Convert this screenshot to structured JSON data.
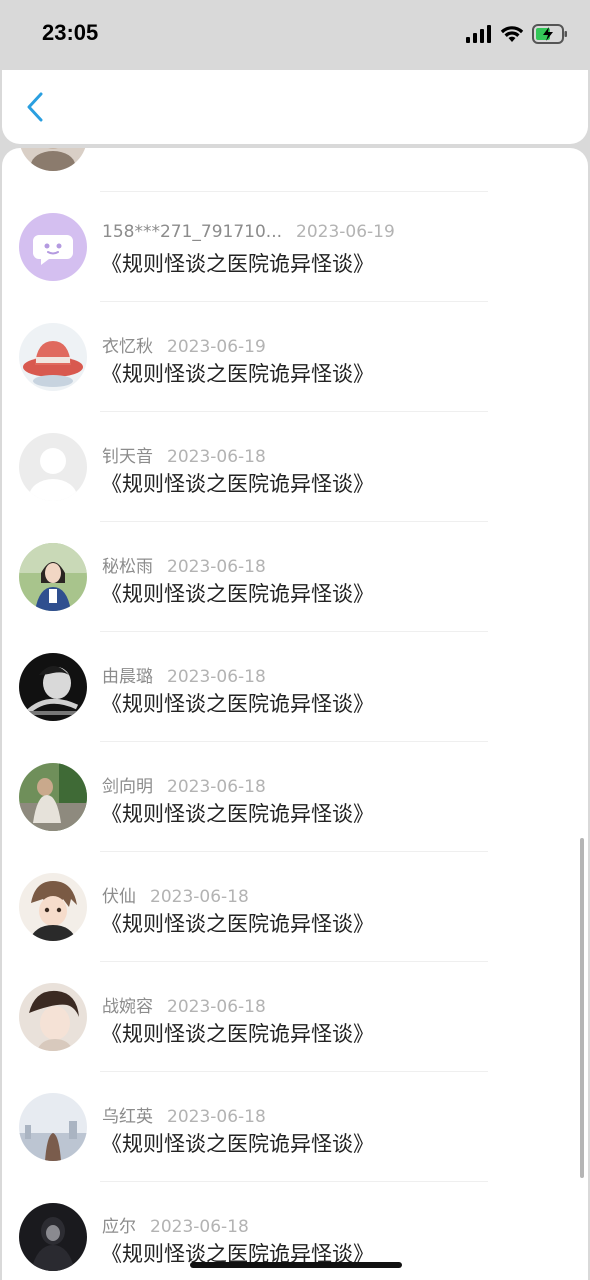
{
  "status_bar": {
    "time": "23:05",
    "signal_icon": "cellular-signal-icon",
    "wifi_icon": "wifi-icon",
    "battery_icon": "battery-charging-icon"
  },
  "nav": {
    "back_icon": "chevron-left-icon",
    "accent_color": "#2a9fe0"
  },
  "items": [
    {
      "name": "",
      "date": "",
      "title": "",
      "avatar": "partial-avatar"
    },
    {
      "name": "158***271_791710...",
      "date": "2023-06-19",
      "title": "《规则怪谈之医院诡异怪谈》",
      "avatar": "default-chat-avatar"
    },
    {
      "name": "衣忆秋",
      "date": "2023-06-19",
      "title": "《规则怪谈之医院诡异怪谈》",
      "avatar": "hat-avatar"
    },
    {
      "name": "钊天音",
      "date": "2023-06-18",
      "title": "《规则怪谈之医院诡异怪谈》",
      "avatar": "blank-user-avatar"
    },
    {
      "name": "秘松雨",
      "date": "2023-06-18",
      "title": "《规则怪谈之医院诡异怪谈》",
      "avatar": "girl-photo-avatar"
    },
    {
      "name": "由晨璐",
      "date": "2023-06-18",
      "title": "《规则怪谈之医院诡异怪谈》",
      "avatar": "bw-photo-avatar"
    },
    {
      "name": "剑向明",
      "date": "2023-06-18",
      "title": "《规则怪谈之医院诡异怪谈》",
      "avatar": "outdoor-photo-avatar"
    },
    {
      "name": "伏仙",
      "date": "2023-06-18",
      "title": "《规则怪谈之医院诡异怪谈》",
      "avatar": "anime-avatar"
    },
    {
      "name": "战婉容",
      "date": "2023-06-18",
      "title": "《规则怪谈之医院诡异怪谈》",
      "avatar": "portrait-avatar"
    },
    {
      "name": "乌红英",
      "date": "2023-06-18",
      "title": "《规则怪谈之医院诡异怪谈》",
      "avatar": "city-avatar"
    },
    {
      "name": "应尔",
      "date": "2023-06-18",
      "title": "《规则怪谈之医院诡异怪谈》",
      "avatar": "dark-photo-avatar"
    }
  ]
}
